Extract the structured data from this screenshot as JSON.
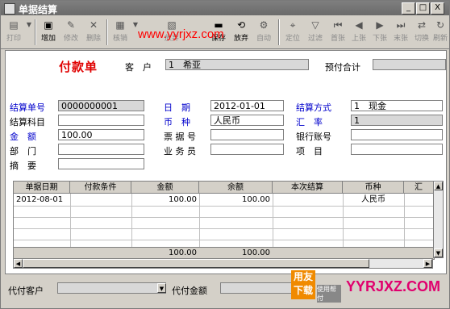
{
  "window": {
    "title": "单据结算",
    "controls": [
      "_",
      "□",
      "X"
    ]
  },
  "toolbar": {
    "buttons": [
      {
        "label": "打印",
        "icon": "printer-icon",
        "enabled": false
      },
      {
        "label": "增加",
        "icon": "add-icon",
        "enabled": true
      },
      {
        "label": "修改",
        "icon": "edit-icon",
        "enabled": false
      },
      {
        "label": "删除",
        "icon": "delete-icon",
        "enabled": false
      },
      {
        "label": "核销",
        "icon": "verify-icon",
        "enabled": false
      },
      {
        "label": "放弃",
        "icon": "abandon-icon",
        "enabled": false
      },
      {
        "label": "保存",
        "icon": "save-icon",
        "enabled": true
      },
      {
        "label": "放弃",
        "icon": "undo-icon",
        "enabled": true
      },
      {
        "label": "自动",
        "icon": "auto-icon",
        "enabled": false
      },
      {
        "label": "定位",
        "icon": "locate-icon",
        "enabled": false
      },
      {
        "label": "过滤",
        "icon": "filter-icon",
        "enabled": false
      },
      {
        "label": "首张",
        "icon": "first-icon",
        "enabled": false
      },
      {
        "label": "上张",
        "icon": "prev-icon",
        "enabled": false
      },
      {
        "label": "下张",
        "icon": "next-icon",
        "enabled": false
      },
      {
        "label": "末张",
        "icon": "last-icon",
        "enabled": false
      },
      {
        "label": "切换",
        "icon": "switch-icon",
        "enabled": false
      },
      {
        "label": "刷新",
        "icon": "refresh-icon",
        "enabled": false
      }
    ],
    "watermark": "www.yyrjxz.com"
  },
  "form": {
    "doc_title": "付款单",
    "customer_label": "客　户",
    "customer_value": "1　希亚",
    "prepay_label": "预付合计",
    "prepay_value": "",
    "fields": {
      "settle_no": {
        "label": "结算单号",
        "value": "0000000001"
      },
      "date": {
        "label": "日　期",
        "value": "2012-01-01"
      },
      "settle_method": {
        "label": "结算方式",
        "value": "1　现金"
      },
      "settle_subject": {
        "label": "结算科目",
        "value": ""
      },
      "currency": {
        "label": "币　种",
        "value": "人民币"
      },
      "rate": {
        "label": "汇　率",
        "value": "1"
      },
      "amount": {
        "label": "金　额",
        "value": "100.00"
      },
      "bill_no": {
        "label": "票 据 号",
        "value": ""
      },
      "bank_account": {
        "label": "银行账号",
        "value": ""
      },
      "department": {
        "label": "部　门",
        "value": ""
      },
      "salesman": {
        "label": "业 务 员",
        "value": ""
      },
      "project": {
        "label": "项　目",
        "value": ""
      },
      "summary": {
        "label": "摘　要",
        "value": ""
      }
    }
  },
  "grid": {
    "columns": [
      "单据日期",
      "付款条件",
      "金额",
      "余额",
      "本次结算",
      "币种",
      "汇"
    ],
    "rows": [
      [
        "2012-08-01",
        "",
        "100.00",
        "100.00",
        "",
        "人民币",
        ""
      ]
    ],
    "totals": [
      "",
      "",
      "100.00",
      "100.00",
      "",
      "",
      ""
    ]
  },
  "bottom": {
    "agent_customer_label": "代付客户",
    "agent_customer_value": "",
    "agent_amount_label": "代付金额",
    "agent_amount_value": "",
    "brand_badge": "用友下载",
    "brand_sub": "使用帮付",
    "brand_url": "YYRJXZ.COM"
  },
  "colors": {
    "accent_red": "#e00000",
    "label_blue": "#0000cc",
    "brand_orange": "#f08a00",
    "brand_pink": "#e0006e"
  }
}
